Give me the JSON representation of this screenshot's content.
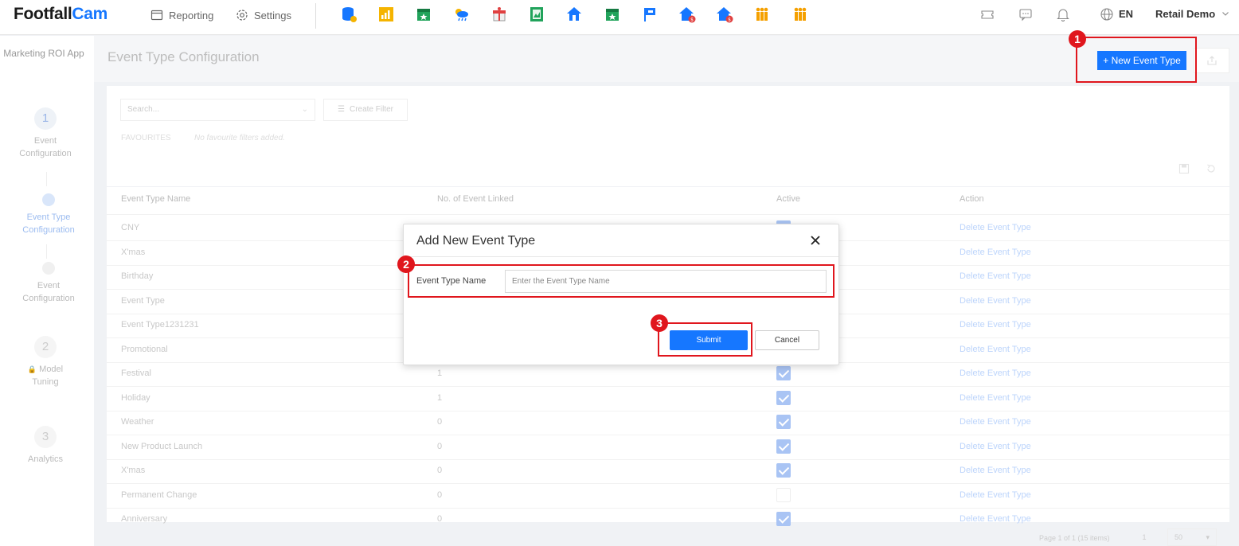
{
  "brand": {
    "name_part1": "Footfall",
    "name_part2": "Cam"
  },
  "nav": {
    "reporting": "Reporting",
    "settings": "Settings"
  },
  "app_icons": [
    "database-icon",
    "chart-icon",
    "calendar-star-icon",
    "weather-icon",
    "gift-icon",
    "report-icon",
    "home-icon",
    "calendar-icon",
    "flag-icon",
    "home-revenue-icon",
    "home-cost-icon",
    "people-icon",
    "people-alt-icon"
  ],
  "topright": {
    "lang": "EN",
    "user": "Retail Demo"
  },
  "sidebar": {
    "title": "Marketing ROI App",
    "steps": [
      {
        "num": "1",
        "label": "Event Configuration"
      },
      {
        "label": "Event Type Configuration"
      },
      {
        "label": "Event Configuration"
      },
      {
        "num": "2",
        "label": "Model Tuning"
      },
      {
        "num": "3",
        "label": "Analytics"
      }
    ]
  },
  "page": {
    "title": "Event Type Configuration",
    "new_button": "+ New Event Type"
  },
  "filters": {
    "search_placeholder": "Search...",
    "create_filter": "Create Filter",
    "favourites_label": "FAVOURITES",
    "favourites_empty": "No favourite filters added."
  },
  "table": {
    "headers": {
      "name": "Event Type Name",
      "linked": "No. of Event Linked",
      "active": "Active",
      "action": "Action"
    },
    "rows": [
      {
        "name": "CNY",
        "linked": "",
        "active": true,
        "action": "Delete Event Type"
      },
      {
        "name": "X'mas",
        "linked": "",
        "active": true,
        "action": "Delete Event Type"
      },
      {
        "name": "Birthday",
        "linked": "",
        "active": true,
        "action": "Delete Event Type"
      },
      {
        "name": "Event Type",
        "linked": "",
        "active": true,
        "action": "Delete Event Type"
      },
      {
        "name": "Event Type1231231",
        "linked": "",
        "active": true,
        "action": "Delete Event Type"
      },
      {
        "name": "Promotional",
        "linked": "",
        "active": true,
        "action": "Delete Event Type"
      },
      {
        "name": "Festival",
        "linked": "1",
        "active": true,
        "action": "Delete Event Type"
      },
      {
        "name": "Holiday",
        "linked": "1",
        "active": true,
        "action": "Delete Event Type"
      },
      {
        "name": "Weather",
        "linked": "0",
        "active": true,
        "action": "Delete Event Type"
      },
      {
        "name": "New Product Launch",
        "linked": "0",
        "active": true,
        "action": "Delete Event Type"
      },
      {
        "name": "X'mas",
        "linked": "0",
        "active": true,
        "action": "Delete Event Type"
      },
      {
        "name": "Permanent Change",
        "linked": "0",
        "active": false,
        "action": "Delete Event Type"
      },
      {
        "name": "Anniversary",
        "linked": "0",
        "active": true,
        "action": "Delete Event Type"
      }
    ]
  },
  "pager": {
    "summary": "Page 1 of 1 (15 items)",
    "page": "1",
    "size": "50"
  },
  "modal": {
    "title": "Add New Event Type",
    "field_label": "Event Type Name",
    "field_placeholder": "Enter the Event Type Name",
    "submit": "Submit",
    "cancel": "Cancel"
  },
  "annotations": [
    "1",
    "2",
    "3"
  ],
  "colors": {
    "accent": "#1677ff",
    "highlight": "#e0161d"
  }
}
